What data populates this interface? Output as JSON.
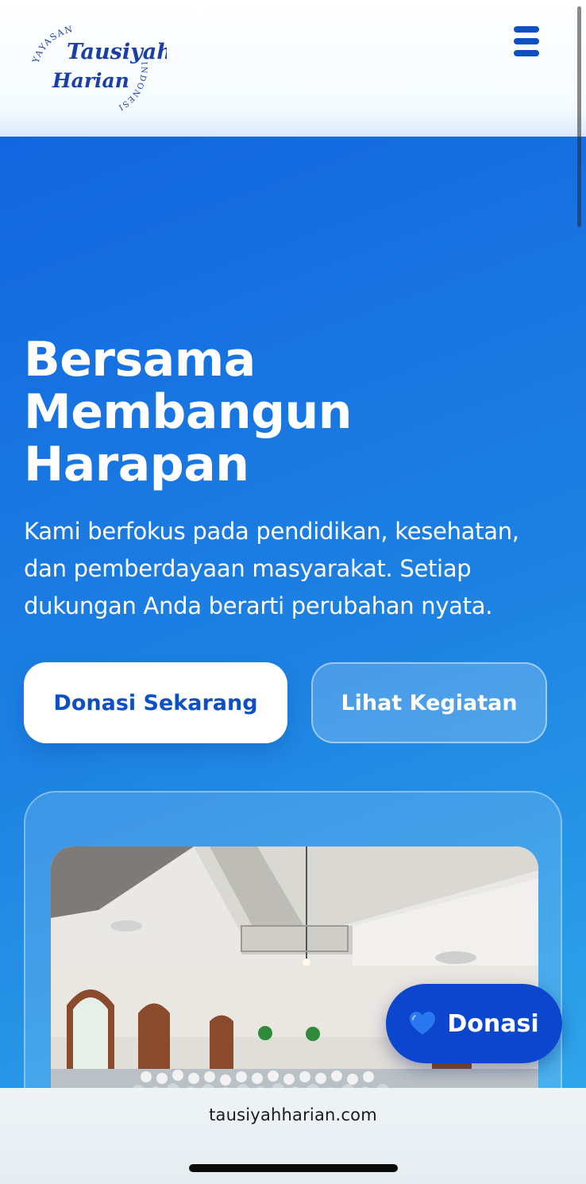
{
  "header": {
    "logo": {
      "arc_top": "YAYASAN",
      "line1": "Tausiyah",
      "line2": "Harian",
      "arc_side": "INDONESIA"
    },
    "menu_icon": "hamburger-menu-icon"
  },
  "hero": {
    "title_lines": [
      "Bersama",
      "Membangun",
      "Harapan"
    ],
    "description_lines": [
      "Kami berfokus pada pendidikan, kesehatan,",
      "dan pemberdayaan masyarakat. Setiap",
      "dukungan Anda berarti perubahan nyata."
    ],
    "primary_button": "Donasi Sekarang",
    "secondary_button": "Lihat Kegiatan"
  },
  "fab": {
    "icon": "blue-heart-icon",
    "label": "Donasi"
  },
  "browser": {
    "url": "tausiyahharian.com"
  },
  "colors": {
    "brand_blue": "#0d4fc4",
    "hero_gradient_start": "#1366e0",
    "hero_gradient_end": "#2fa5ea",
    "fab_blue": "#0c46cf",
    "white": "#ffffff"
  }
}
